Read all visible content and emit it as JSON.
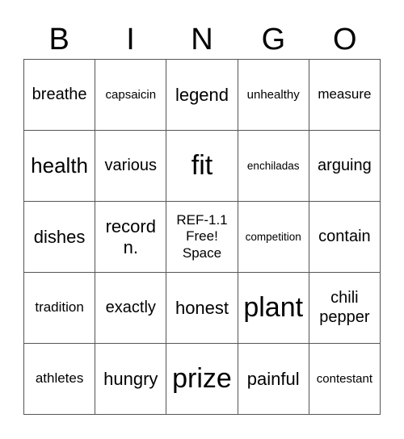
{
  "header": [
    "B",
    "I",
    "N",
    "G",
    "O"
  ],
  "cells": [
    {
      "text": "breathe",
      "size": "s-ms"
    },
    {
      "text": "capsaicin",
      "size": "s-xs"
    },
    {
      "text": "legend",
      "size": "s-m"
    },
    {
      "text": "unhealthy",
      "size": "s-xs"
    },
    {
      "text": "measure",
      "size": "s-s"
    },
    {
      "text": "health",
      "size": "s-l"
    },
    {
      "text": "various",
      "size": "s-ms"
    },
    {
      "text": "fit",
      "size": "s-xl"
    },
    {
      "text": "enchiladas",
      "size": "s-xxs"
    },
    {
      "text": "arguing",
      "size": "s-ms"
    },
    {
      "text": "dishes",
      "size": "s-m"
    },
    {
      "text": "record n.",
      "size": "s-m"
    },
    {
      "text": "REF-1.1 Free! Space",
      "size": "s-s"
    },
    {
      "text": "competition",
      "size": "s-xxs"
    },
    {
      "text": "contain",
      "size": "s-ms"
    },
    {
      "text": "tradition",
      "size": "s-s"
    },
    {
      "text": "exactly",
      "size": "s-ms"
    },
    {
      "text": "honest",
      "size": "s-m"
    },
    {
      "text": "plant",
      "size": "s-xl"
    },
    {
      "text": "chili pepper",
      "size": "s-ms"
    },
    {
      "text": "athletes",
      "size": "s-s"
    },
    {
      "text": "hungry",
      "size": "s-m"
    },
    {
      "text": "prize",
      "size": "s-xl"
    },
    {
      "text": "painful",
      "size": "s-m"
    },
    {
      "text": "contestant",
      "size": "s-xs"
    }
  ]
}
